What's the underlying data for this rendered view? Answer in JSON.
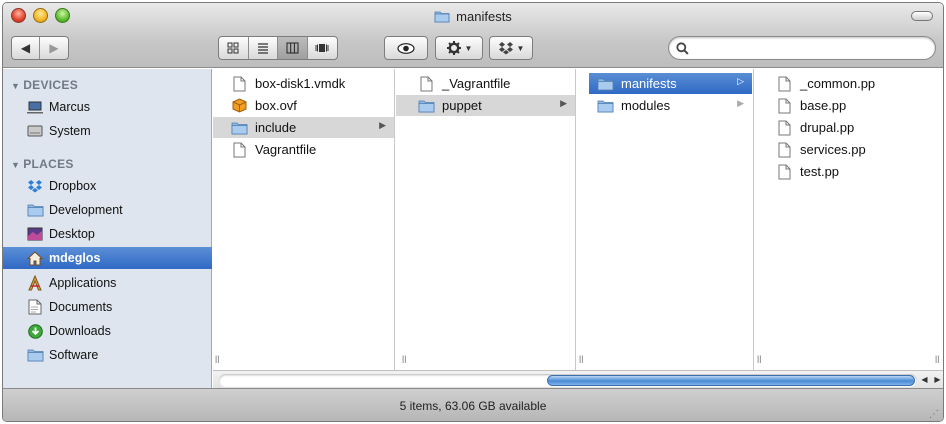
{
  "window": {
    "title": "manifests"
  },
  "toolbar": {
    "nav": {
      "back": "◀",
      "forward": "▶"
    },
    "view_modes": [
      "icon-view",
      "list-view",
      "column-view",
      "coverflow-view"
    ],
    "active_view": "column-view",
    "quicklook_icon": "eye-icon",
    "action_icon": "gear-icon",
    "dropbox_icon": "dropbox-icon",
    "search": {
      "placeholder": "",
      "value": ""
    }
  },
  "sidebar": {
    "devices_header": "DEVICES",
    "places_header": "PLACES",
    "devices": [
      {
        "label": "Marcus",
        "icon": "laptop-icon"
      },
      {
        "label": "System",
        "icon": "harddisk-icon"
      }
    ],
    "places": [
      {
        "label": "Dropbox",
        "icon": "dropbox-icon"
      },
      {
        "label": "Development",
        "icon": "folder-icon"
      },
      {
        "label": "Desktop",
        "icon": "desktop-icon"
      },
      {
        "label": "mdeglos",
        "icon": "home-icon",
        "selected": true
      },
      {
        "label": "Applications",
        "icon": "applications-icon"
      },
      {
        "label": "Documents",
        "icon": "documents-icon"
      },
      {
        "label": "Downloads",
        "icon": "downloads-icon"
      },
      {
        "label": "Software",
        "icon": "folder-icon"
      }
    ]
  },
  "columns": [
    {
      "items": [
        {
          "label": "box-disk1.vmdk",
          "type": "file"
        },
        {
          "label": "box.ovf",
          "type": "package"
        },
        {
          "label": "include",
          "type": "folder",
          "state": "grey"
        },
        {
          "label": "Vagrantfile",
          "type": "file"
        }
      ]
    },
    {
      "items": [
        {
          "label": "_Vagrantfile",
          "type": "file"
        },
        {
          "label": "puppet",
          "type": "folder",
          "state": "grey"
        }
      ]
    },
    {
      "items": [
        {
          "label": "manifests",
          "type": "folder",
          "state": "blue"
        },
        {
          "label": "modules",
          "type": "folder"
        }
      ]
    },
    {
      "items": [
        {
          "label": "_common.pp",
          "type": "file"
        },
        {
          "label": "base.pp",
          "type": "file"
        },
        {
          "label": "drupal.pp",
          "type": "file"
        },
        {
          "label": "services.pp",
          "type": "file"
        },
        {
          "label": "test.pp",
          "type": "file"
        }
      ]
    }
  ],
  "status": {
    "text": "5 items, 63.06 GB available"
  },
  "colors": {
    "selection_blue": "#2f6ac5",
    "sidebar_bg": "#dfe5ee"
  }
}
